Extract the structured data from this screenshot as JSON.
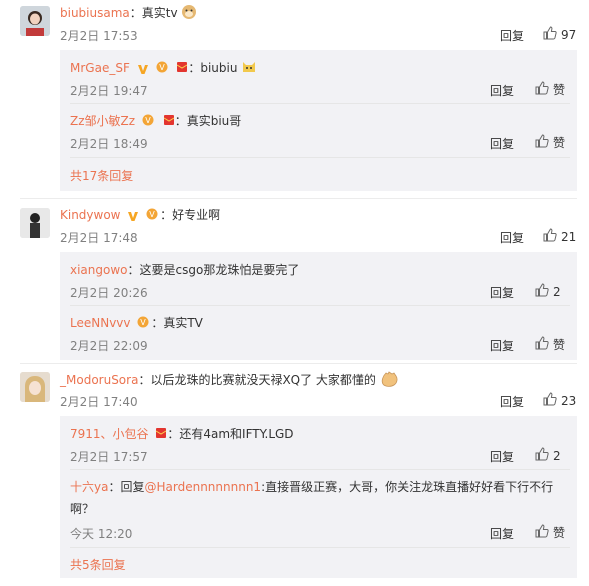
{
  "comments": [
    {
      "user": "biubiusama",
      "text": "：真实tv",
      "time": "2月2日 17:53",
      "reply_label": "回复",
      "likes": "97",
      "replies": [
        {
          "user": "MrGae_SF",
          "text": "：biubiu",
          "time": "2月2日 19:47",
          "reply_label": "回复",
          "like_label": "赞"
        },
        {
          "user": "Zz邹小敏Zz",
          "text": "：真实biu哥",
          "time": "2月2日 18:49",
          "reply_label": "回复",
          "like_label": "赞"
        }
      ],
      "more": "共17条回复"
    },
    {
      "user": "Kindywow",
      "text": "：好专业啊",
      "time": "2月2日 17:48",
      "reply_label": "回复",
      "likes": "21",
      "replies": [
        {
          "user": "xiangowo",
          "text": "：这要是csgo那龙珠怕是要完了",
          "time": "2月2日 20:26",
          "reply_label": "回复",
          "likes": "2"
        },
        {
          "user": "LeeNNvvv",
          "text": "：真实TV",
          "time": "2月2日 22:09",
          "reply_label": "回复",
          "like_label": "赞"
        }
      ]
    },
    {
      "user": "_ModoruSora",
      "text": "：以后龙珠的比赛就没天禄XQ了 大家都懂的",
      "time": "2月2日 17:40",
      "reply_label": "回复",
      "likes": "23",
      "replies": [
        {
          "user": "7911、小包谷",
          "text": "：还有4am和IFTY.LGD",
          "time": "2月2日 17:57",
          "reply_label": "回复",
          "likes": "2"
        },
        {
          "user": "十六ya",
          "text_prefix": "：回复",
          "mention": "@Hardennnnnnnn1",
          "text": ":直接晋级正赛，大哥，你关注龙珠直播好好看下行不行",
          "text_line2": "啊？",
          "time": "今天 12:20",
          "reply_label": "回复",
          "like_label": "赞"
        }
      ],
      "more": "共5条回复"
    }
  ],
  "colors": {
    "username": "#eb7350",
    "reply_bg": "#f2f2f5",
    "meta": "#808080"
  }
}
